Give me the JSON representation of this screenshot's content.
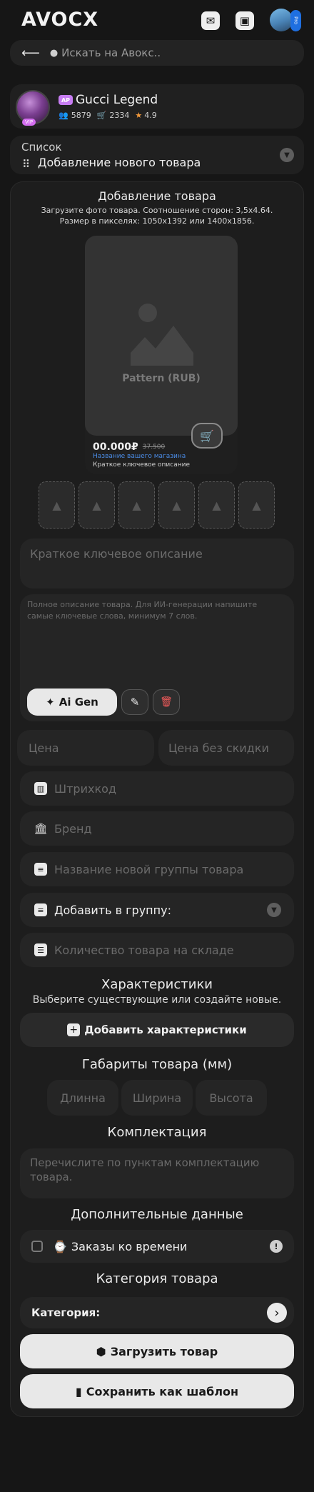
{
  "header": {
    "logo": "AVOCX",
    "pro_badge": "Pro"
  },
  "search": {
    "placeholder": "Искать на Авокс.."
  },
  "user": {
    "name": "Gucci Legend",
    "badge": "AP",
    "level": "VIP",
    "followers": "5879",
    "orders": "2334",
    "rating": "4.9"
  },
  "list": {
    "label": "Список",
    "value": "Добавление нового товара"
  },
  "form": {
    "title": "Добавление товара",
    "hint1": "Загрузите фото товара. Соотношение сторон: 3,5x4.64.",
    "hint2": "Размер в пикселях: 1050x1392 или 1400x1856.",
    "preview": {
      "pattern": "Pattern (RUB)",
      "price": "00.000₽",
      "old_price": "37.500",
      "shop": "Название вашего магазина",
      "short": "Краткое ключевое описание"
    },
    "short_desc_placeholder": "Краткое ключевое описание",
    "full_desc_placeholder": "Полное описание товара. Для ИИ-генерации напишите самые ключевые слова, минимум 7 слов.",
    "ai_gen": "Ai Gen",
    "price_placeholder": "Цена",
    "price_nodiscount_placeholder": "Цена без скидки",
    "barcode_placeholder": "Штрихкод",
    "brand_placeholder": "Бренд",
    "group_name_placeholder": "Название новой группы товара",
    "add_to_group": "Добавить в группу:",
    "stock_placeholder": "Количество товара на складе",
    "characteristics_title": "Характеристики",
    "characteristics_hint": "Выберите существующие или создайте новые.",
    "add_characteristics": "Добавить характеристики",
    "dimensions_title": "Габариты товара (мм)",
    "dims": [
      "Длинна",
      "Ширина",
      "Высота"
    ],
    "kit_title": "Комплектация",
    "kit_placeholder": "Перечислите по пунктам комплектацию товара.",
    "extra_title": "Дополнительные данные",
    "timed_orders": "Заказы ко времени",
    "category_title": "Категория товара",
    "category_label": "Категория:",
    "upload_button": "Загрузить товар",
    "save_template_button": "Сохранить как шаблон"
  }
}
